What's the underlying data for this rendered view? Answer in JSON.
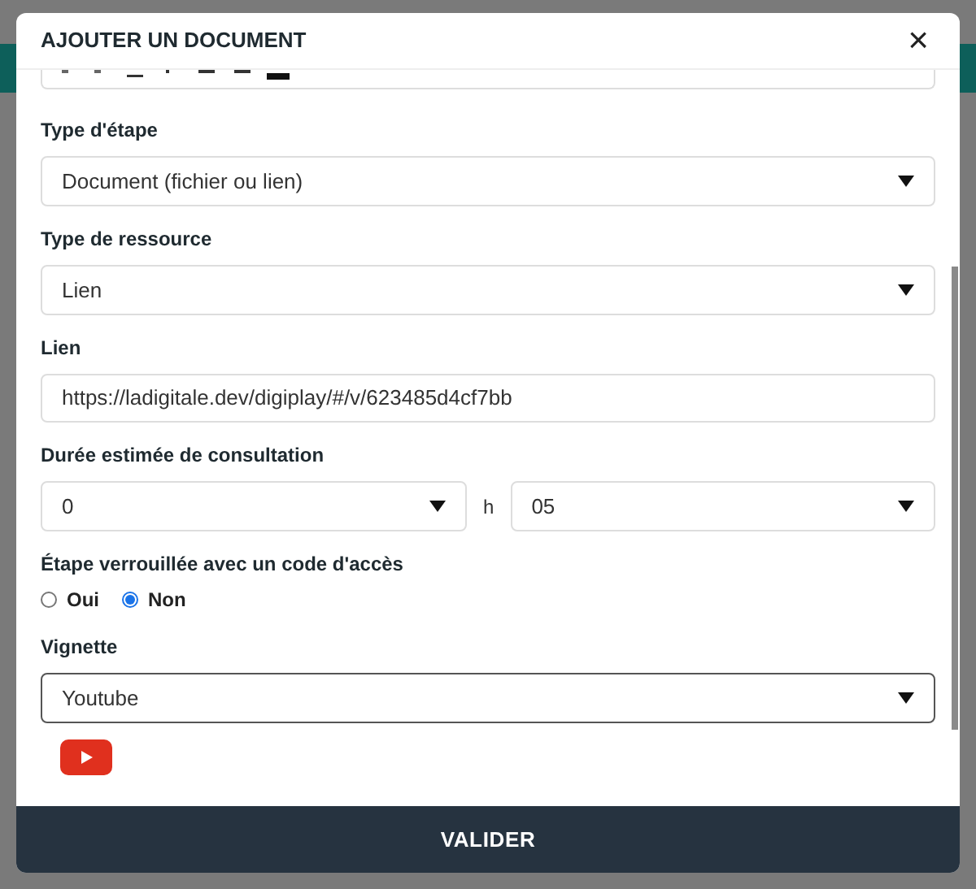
{
  "dialog": {
    "title": "AJOUTER UN DOCUMENT",
    "close": "×"
  },
  "fields": [
    {
      "kind": "select",
      "label": "Type d'étape",
      "value": "Document (fichier ou lien)",
      "focused": false
    },
    {
      "kind": "select",
      "label": "Type de ressource",
      "value": "Lien",
      "focused": false
    },
    {
      "kind": "text",
      "label": "Lien",
      "value": "https://ladigitale.dev/digiplay/#/v/623485d4cf7bb",
      "focused": false
    },
    {
      "kind": "duration",
      "label": "Durée estimée de consultation",
      "hours": "0",
      "unit": "h",
      "minutes": "05"
    },
    {
      "kind": "radio",
      "label": "Étape verrouillée avec un code d'accès",
      "options": [
        {
          "label": "Oui",
          "selected": false
        },
        {
          "label": "Non",
          "selected": true
        }
      ]
    },
    {
      "kind": "select",
      "label": "Vignette",
      "value": "Youtube",
      "focused": true
    }
  ],
  "footer": {
    "button": "VALIDER"
  }
}
